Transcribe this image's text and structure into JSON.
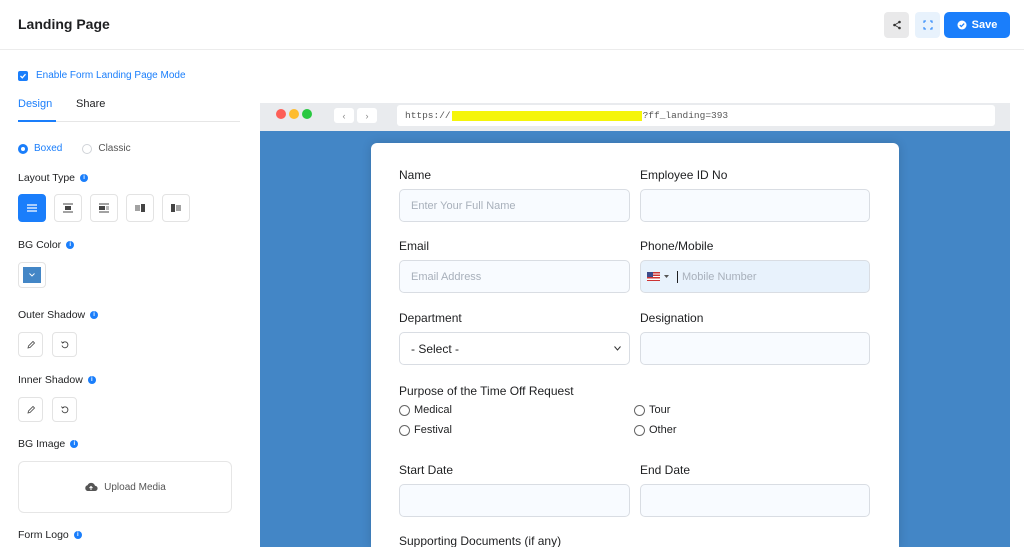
{
  "header": {
    "title": "Landing Page",
    "save_label": "Save"
  },
  "enable_mode": {
    "label": "Enable Form Landing Page Mode",
    "checked": true
  },
  "tabs": [
    {
      "label": "Design",
      "active": true
    },
    {
      "label": "Share",
      "active": false
    }
  ],
  "style_options": [
    {
      "label": "Boxed",
      "selected": true
    },
    {
      "label": "Classic",
      "selected": false
    }
  ],
  "sections": {
    "layout_type": "Layout Type",
    "bg_color": "BG Color",
    "outer_shadow": "Outer Shadow",
    "inner_shadow": "Inner Shadow",
    "bg_image": "BG Image",
    "form_logo": "Form Logo"
  },
  "upload_media_label": "Upload Media",
  "bg_color_value": "#4386c6",
  "accent_color": "#1a7efb",
  "browser": {
    "url_prefix": "https://",
    "url_suffix": "?ff_landing=393"
  },
  "form": {
    "name_label": "Name",
    "name_placeholder": "Enter Your Full Name",
    "employee_id_label": "Employee ID No",
    "email_label": "Email",
    "email_placeholder": "Email Address",
    "phone_label": "Phone/Mobile",
    "phone_placeholder": "Mobile Number",
    "department_label": "Department",
    "department_value": "- Select -",
    "designation_label": "Designation",
    "purpose_label": "Purpose of the Time Off Request",
    "purpose_options": [
      "Medical",
      "Tour",
      "Festival",
      "Other"
    ],
    "start_date_label": "Start Date",
    "end_date_label": "End Date",
    "supporting_docs_label": "Supporting Documents (if any)"
  }
}
